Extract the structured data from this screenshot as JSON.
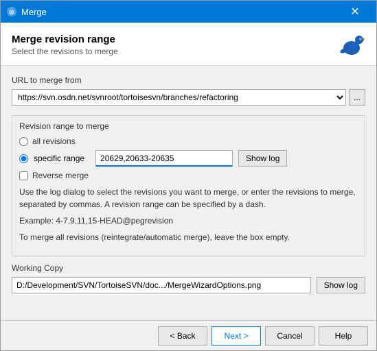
{
  "titlebar": {
    "title": "Merge",
    "close_label": "✕"
  },
  "header": {
    "title": "Merge revision range",
    "subtitle": "Select the revisions to merge"
  },
  "url_section": {
    "label": "URL to merge from",
    "url_value": "https://svn.osdn.net/svnroot/tortoisesvn/branches/refactoring",
    "browse_label": "..."
  },
  "revision_section": {
    "title": "Revision range to merge",
    "all_revisions_label": "all revisions",
    "specific_range_label": "specific range",
    "specific_range_value": "20629,20633-20635",
    "show_log_label": "Show log",
    "reverse_merge_label": "Reverse merge",
    "info_text": "Use the log dialog to select the revisions you want to merge, or enter the revisions to merge, separated by commas. A revision range can be specified by a dash.",
    "example_text": "Example: 4-7,9,11,15-HEAD@pegrevision",
    "auto_merge_text": "To merge all revisions (reintegrate/automatic merge), leave the box empty."
  },
  "working_copy": {
    "label": "Working Copy",
    "path": "D:/Development/SVN/TortoiseSVN/doc.../MergeWizardOptions.png",
    "show_log_label": "Show log"
  },
  "footer": {
    "back_label": "< Back",
    "next_label": "Next >",
    "cancel_label": "Cancel",
    "help_label": "Help"
  }
}
